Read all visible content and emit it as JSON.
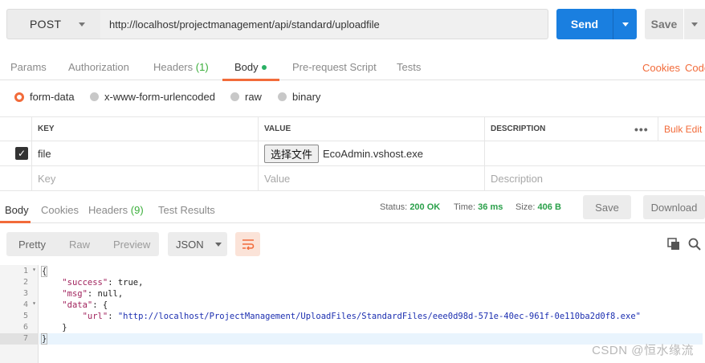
{
  "request": {
    "method": "POST",
    "url": "http://localhost/projectmanagement/api/standard/uploadfile",
    "send_label": "Send",
    "save_label": "Save"
  },
  "req_tabs": {
    "params": "Params",
    "authorization": "Authorization",
    "headers": "Headers",
    "headers_count": "(1)",
    "body": "Body",
    "prerequest": "Pre-request Script",
    "tests": "Tests",
    "cookies": "Cookies",
    "code": "Code"
  },
  "body_types": {
    "form_data": "form-data",
    "urlencoded": "x-www-form-urlencoded",
    "raw": "raw",
    "binary": "binary",
    "selected": "form-data"
  },
  "kv_table": {
    "headers": {
      "key": "KEY",
      "value": "VALUE",
      "description": "DESCRIPTION",
      "bulk_edit": "Bulk Edit"
    },
    "rows": [
      {
        "checked": true,
        "key": "file",
        "file_button": "选择文件",
        "file_name": "EcoAdmin.vshost.exe",
        "description": ""
      }
    ],
    "placeholders": {
      "key": "Key",
      "value": "Value",
      "description": "Description"
    }
  },
  "response": {
    "tabs": {
      "body": "Body",
      "cookies": "Cookies",
      "headers": "Headers",
      "headers_count": "(9)",
      "test_results": "Test Results"
    },
    "status_label": "Status:",
    "status_value": "200 OK",
    "time_label": "Time:",
    "time_value": "36 ms",
    "size_label": "Size:",
    "size_value": "406 B",
    "save_label": "Save",
    "download_label": "Download"
  },
  "format_bar": {
    "pretty": "Pretty",
    "raw": "Raw",
    "preview": "Preview",
    "format": "JSON"
  },
  "code": {
    "line_numbers": [
      "1",
      "2",
      "3",
      "4",
      "5",
      "6",
      "7"
    ],
    "lines": {
      "l1": "{",
      "l2_key": "\"success\"",
      "l2_rest": ": true,",
      "l3_key": "\"msg\"",
      "l3_rest": ": null,",
      "l4_key": "\"data\"",
      "l4_rest": ": {",
      "l5_key": "\"url\"",
      "l5_colon": ": ",
      "l5_val": "\"http://localhost/ProjectManagement/UploadFiles/StandardFiles/eee0d98d-571e-40ec-961f-0e110ba2d0f8.exe\"",
      "l6": "}",
      "l7": "}"
    }
  },
  "watermark": "CSDN @恒水缘流",
  "colors": {
    "accent": "#f26b3a",
    "send": "#1a7fe0",
    "status_ok": "#2aa04a"
  }
}
